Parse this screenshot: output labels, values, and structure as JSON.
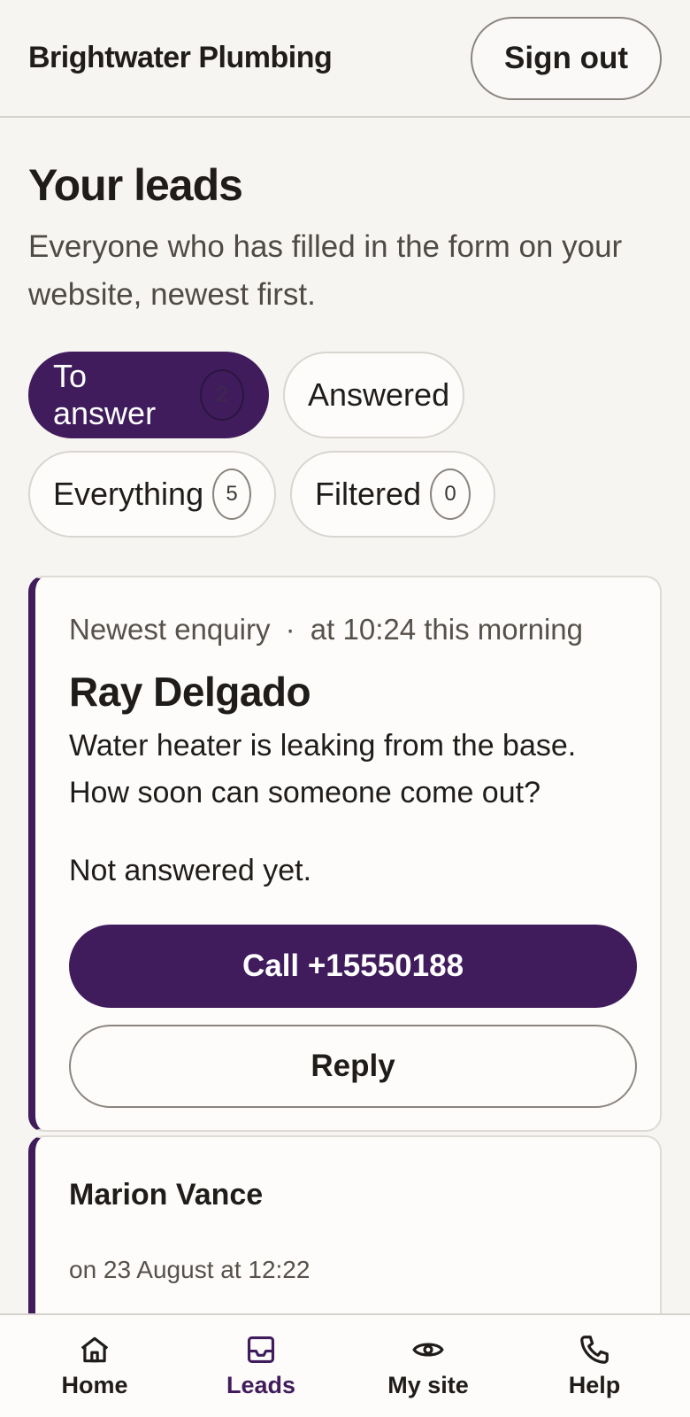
{
  "header": {
    "brand": "Brightwater Plumbing",
    "sign_out_label": "Sign out"
  },
  "page": {
    "title": "Your leads",
    "subtitle": "Everyone who has filled in the form on your website, newest first."
  },
  "filters": [
    {
      "label": "To answer",
      "count": "2",
      "active": true
    },
    {
      "label": "Answered",
      "count": null,
      "active": false
    },
    {
      "label": "Everything",
      "count": "5",
      "active": false
    },
    {
      "label": "Filtered",
      "count": "0",
      "active": false
    }
  ],
  "leads": [
    {
      "meta_label": "Newest enquiry",
      "meta_separator": "·",
      "meta_time": "at 10:24 this morning",
      "name": "Ray Delgado",
      "message": "Water heater is leaking from the base. How soon can someone come out?",
      "status": "Not answered yet.",
      "call_label": "Call +15550188",
      "reply_label": "Reply"
    },
    {
      "name": "Marion Vance",
      "date": "on 23 August at 12:22"
    }
  ],
  "nav": [
    {
      "label": "Home",
      "icon": "home-icon",
      "active": false
    },
    {
      "label": "Leads",
      "icon": "inbox-icon",
      "active": true
    },
    {
      "label": "My site",
      "icon": "eye-icon",
      "active": false
    },
    {
      "label": "Help",
      "icon": "phone-icon",
      "active": false
    }
  ],
  "colors": {
    "accent": "#401c5c",
    "background": "#f7f5f2",
    "card": "#fdfcfa"
  }
}
